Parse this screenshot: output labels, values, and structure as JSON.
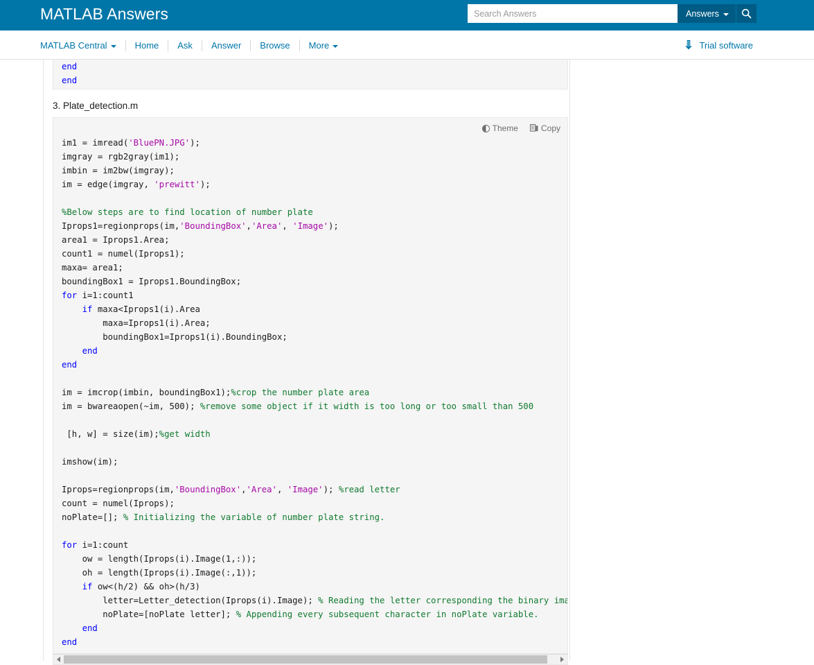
{
  "header": {
    "brand": "MATLAB Answers",
    "brand_color": "#0076A8",
    "search": {
      "placeholder": "Search Answers",
      "value": "",
      "scope_label": "Answers",
      "search_icon": "search-icon",
      "caret_icon": "chevron-down-icon"
    }
  },
  "subnav": {
    "items": [
      {
        "label": "MATLAB Central",
        "has_caret": true
      },
      {
        "label": "Home",
        "has_caret": false
      },
      {
        "label": "Ask",
        "has_caret": false
      },
      {
        "label": "Answer",
        "has_caret": false
      },
      {
        "label": "Browse",
        "has_caret": false
      },
      {
        "label": "More",
        "has_caret": true
      }
    ],
    "trial": {
      "label": "Trial software",
      "icon": "download-icon"
    }
  },
  "main": {
    "partial_code_above": "end\nend",
    "section_heading": "3. Plate_detection.m",
    "code_tools": {
      "theme_label": "Theme",
      "theme_icon": "contrast-half-circle-icon",
      "copy_label": "Copy",
      "copy_icon": "copy-pages-icon"
    },
    "code_listing": [
      {
        "t": "plain",
        "v": "im1 = imread("
      },
      {
        "t": "string",
        "v": "'BluePN.JPG'"
      },
      {
        "t": "plain",
        "v": ");"
      }
    ],
    "code_text": "im1 = imread('BluePN.JPG');\nimgray = rgb2gray(im1);\nimbin = im2bw(imgray);\nim = edge(imgray, 'prewitt');\n\n%Below steps are to find location of number plate\nIprops1=regionprops(im,'BoundingBox','Area', 'Image');\narea1 = Iprops1.Area;\ncount1 = numel(Iprops1);\nmaxa= area1;\nboundingBox1 = Iprops1.BoundingBox;\nfor i=1:count1\n    if maxa<Iprops1(i).Area\n        maxa=Iprops1(i).Area;\n        boundingBox1=Iprops1(i).BoundingBox;\n    end\nend\n\nim = imcrop(imbin, boundingBox1);%crop the number plate area\nim = bwareaopen(~im, 500); %remove some object if it width is too long or too small than 500\n\n [h, w] = size(im);%get width\n\nimshow(im);\n\nIprops=regionprops(im,'BoundingBox','Area', 'Image'); %read letter\ncount = numel(Iprops);\nnoPlate=[]; % Initializing the variable of number plate string.\n\nfor i=1:count\n    ow = length(Iprops(i).Image(1,:));\n    oh = length(Iprops(i).Image(:,1));\n    if ow<(h/2) && oh>(h/3)\n        letter=Letter_detection(Iprops(i).Image); % Reading the letter corresponding the binary image 'N'\n        noPlate=[noPlate letter]; % Appending every subsequent character in noPlate variable.\n    end\nend",
    "scrollbar": {
      "left_arrow": "chevron-left-icon",
      "right_arrow": "chevron-right-icon"
    }
  },
  "colors": {
    "header_blue": "#0076A8",
    "header_blue_dark": "#005C85",
    "code_bg": "#f5f5f5",
    "keyword": "#0000FF",
    "string": "#A709A7",
    "comment": "#117A30"
  }
}
